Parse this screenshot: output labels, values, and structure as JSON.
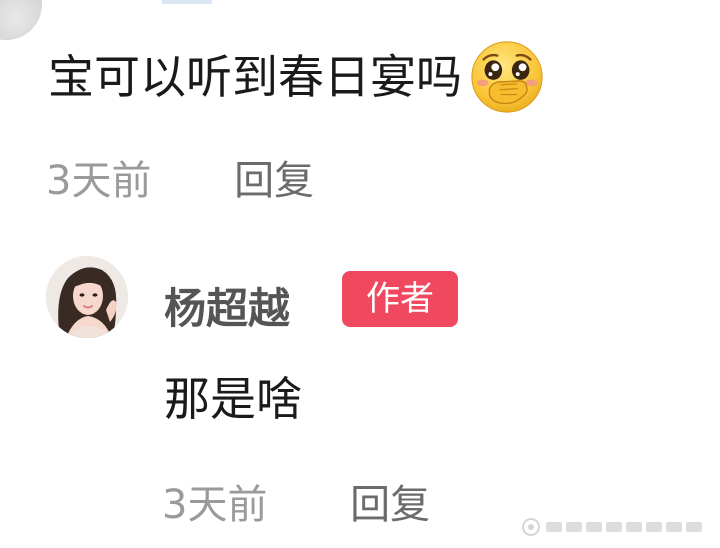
{
  "comment": {
    "text": "宝可以听到春日宴吗",
    "emoji": "pleading-face-hand-over-mouth",
    "time": "3天前",
    "reply_label": "回复"
  },
  "reply": {
    "username": "杨超越",
    "badge": "作者",
    "text": "那是啥",
    "time": "3天前",
    "reply_label": "回复"
  },
  "colors": {
    "badge_bg": "#f0485f",
    "meta_gray": "#9a9a9a",
    "username_gray": "#555555"
  }
}
